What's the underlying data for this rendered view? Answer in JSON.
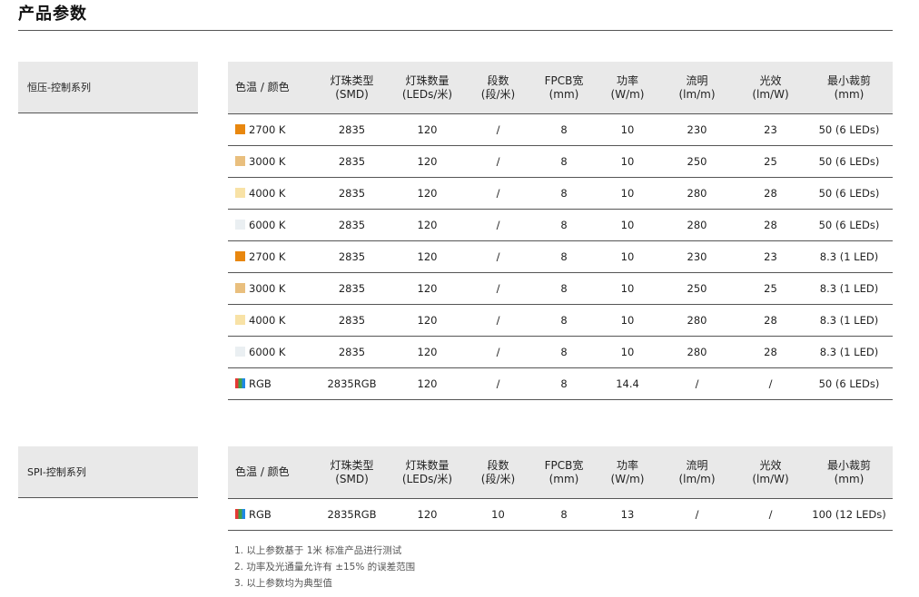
{
  "page": {
    "title": "产品参数"
  },
  "columns": [
    [
      "色温 / 颜色"
    ],
    [
      "灯珠类型",
      "(SMD)"
    ],
    [
      "灯珠数量",
      "(LEDs/米)"
    ],
    [
      "段数",
      "(段/米)"
    ],
    [
      "FPCB宽",
      "(mm)"
    ],
    [
      "功率",
      "(W/m)"
    ],
    [
      "流明",
      "(lm/m)"
    ],
    [
      "光效",
      "(lm/W)"
    ],
    [
      "最小裁剪",
      "(mm)"
    ]
  ],
  "colors": {
    "2700K": "#e8870f",
    "3000K": "#e9bf7e",
    "4000K": "#f8e2a6",
    "6000K": "#eaeff2"
  },
  "series": [
    {
      "label": "恒压-控制系列",
      "rows": [
        {
          "swatch": "#e8870f",
          "color": "2700 K",
          "smd": "2835",
          "leds": "120",
          "segments": "/",
          "fpcb": "8",
          "power": "10",
          "lumen": "230",
          "efficacy": "23",
          "cut": "50 (6 LEDs)"
        },
        {
          "swatch": "#e9bf7e",
          "color": "3000 K",
          "smd": "2835",
          "leds": "120",
          "segments": "/",
          "fpcb": "8",
          "power": "10",
          "lumen": "250",
          "efficacy": "25",
          "cut": "50 (6 LEDs)"
        },
        {
          "swatch": "#f8e2a6",
          "color": "4000 K",
          "smd": "2835",
          "leds": "120",
          "segments": "/",
          "fpcb": "8",
          "power": "10",
          "lumen": "280",
          "efficacy": "28",
          "cut": "50 (6 LEDs)"
        },
        {
          "swatch": "#eaeff2",
          "color": "6000 K",
          "smd": "2835",
          "leds": "120",
          "segments": "/",
          "fpcb": "8",
          "power": "10",
          "lumen": "280",
          "efficacy": "28",
          "cut": "50 (6 LEDs)"
        },
        {
          "swatch": "#e8870f",
          "color": "2700 K",
          "smd": "2835",
          "leds": "120",
          "segments": "/",
          "fpcb": "8",
          "power": "10",
          "lumen": "230",
          "efficacy": "23",
          "cut": "8.3 (1 LED)"
        },
        {
          "swatch": "#e9bf7e",
          "color": "3000 K",
          "smd": "2835",
          "leds": "120",
          "segments": "/",
          "fpcb": "8",
          "power": "10",
          "lumen": "250",
          "efficacy": "25",
          "cut": "8.3 (1 LED)"
        },
        {
          "swatch": "#f8e2a6",
          "color": "4000 K",
          "smd": "2835",
          "leds": "120",
          "segments": "/",
          "fpcb": "8",
          "power": "10",
          "lumen": "280",
          "efficacy": "28",
          "cut": "8.3 (1 LED)"
        },
        {
          "swatch": "#eaeff2",
          "color": "6000 K",
          "smd": "2835",
          "leds": "120",
          "segments": "/",
          "fpcb": "8",
          "power": "10",
          "lumen": "280",
          "efficacy": "28",
          "cut": "8.3 (1 LED)"
        },
        {
          "swatch": "rgb",
          "color": "RGB",
          "smd": "2835RGB",
          "leds": "120",
          "segments": "/",
          "fpcb": "8",
          "power": "14.4",
          "lumen": "/",
          "efficacy": "/",
          "cut": "50 (6 LEDs)"
        }
      ]
    },
    {
      "label": "SPI-控制系列",
      "rows": [
        {
          "swatch": "rgb",
          "color": "RGB",
          "smd": "2835RGB",
          "leds": "120",
          "segments": "10",
          "fpcb": "8",
          "power": "13",
          "lumen": "/",
          "efficacy": "/",
          "cut": "100 (12 LEDs)"
        }
      ]
    }
  ],
  "notes": [
    "1. 以上参数基于 1米 标准产品进行测试",
    "2. 功率及光通量允许有 ±15% 的误差范围",
    "3. 以上参数均为典型值"
  ]
}
